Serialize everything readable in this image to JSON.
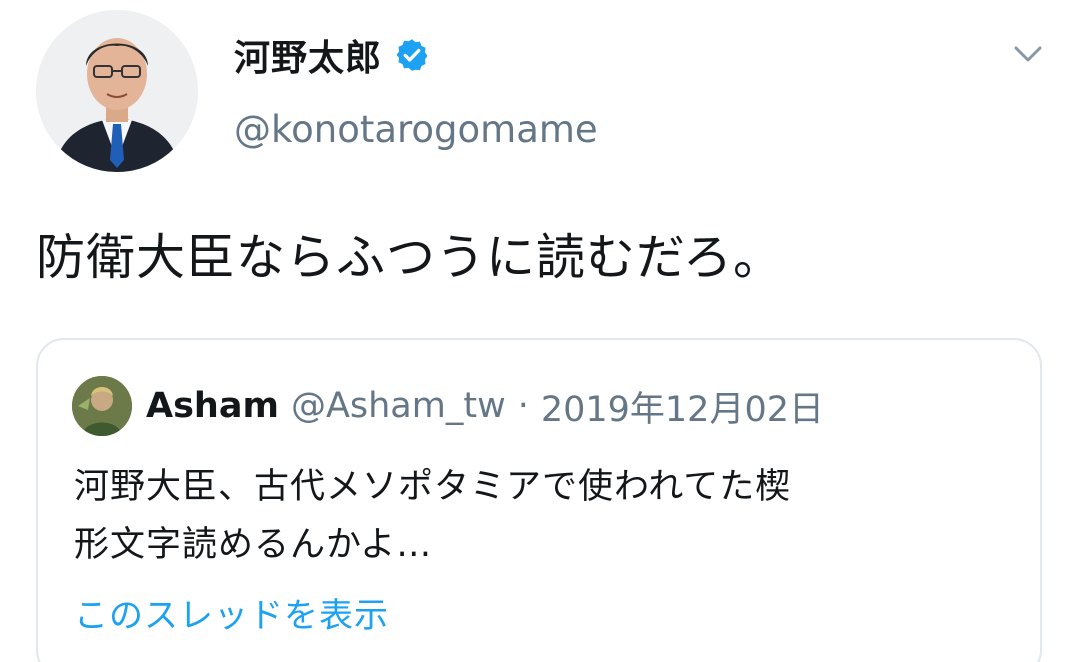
{
  "tweet": {
    "display_name": "河野太郎",
    "handle": "@konotarogomame",
    "text": "防衛大臣ならふつうに読むだろ。",
    "icons": {
      "verified": "verified-badge-icon",
      "menu": "chevron-down-icon"
    },
    "colors": {
      "accent": "#1da1f2",
      "secondary_text": "#657786",
      "primary_text": "#14171a",
      "border": "#e1e8ed"
    }
  },
  "quote": {
    "display_name": "Asham",
    "handle": "@Asham_tw",
    "separator": "·",
    "date": "2019年12月02日",
    "text_lines": [
      "河野大臣、古代メソポタミアで使われてた楔",
      "形文字読めるんかよ…"
    ],
    "show_thread_label": "このスレッドを表示"
  }
}
